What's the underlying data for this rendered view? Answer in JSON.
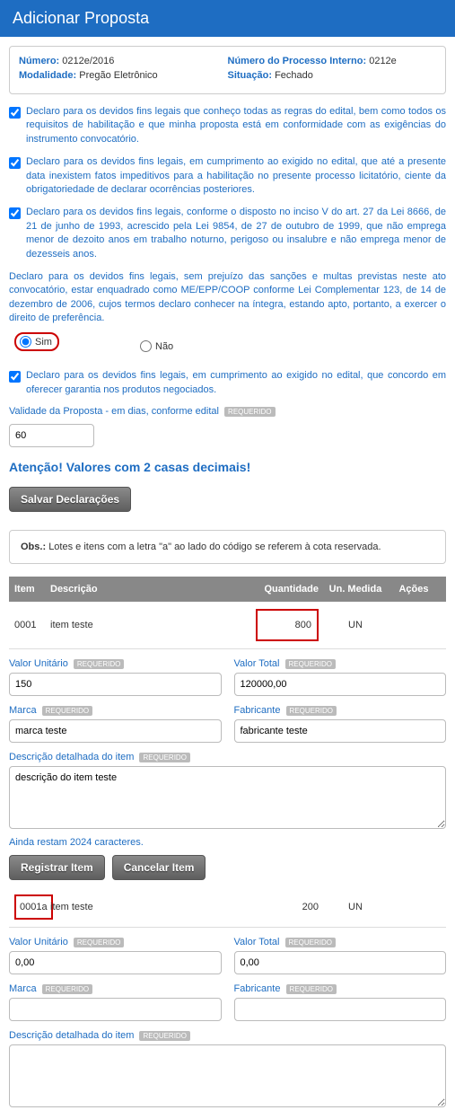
{
  "header": {
    "title": "Adicionar Proposta"
  },
  "info": {
    "numero_label": "Número:",
    "numero": "0212e/2016",
    "modalidade_label": "Modalidade:",
    "modalidade": "Pregão Eletrônico",
    "proc_interno_label": "Número do Processo Interno:",
    "proc_interno": "0212e",
    "situacao_label": "Situação:",
    "situacao": "Fechado"
  },
  "decl": {
    "d1": "Declaro para os devidos fins legais que conheço todas as regras do edital, bem como todos os requisitos de habilitação e que minha proposta está em conformidade com as exigências do instrumento convocatório.",
    "d2": "Declaro para os devidos fins legais, em cumprimento ao exigido no edital, que até a presente data inexistem fatos impeditivos para a habilitação no presente processo licitatório, ciente da obrigatoriedade de declarar ocorrências posteriores.",
    "d3": "Declaro para os devidos fins legais, conforme o disposto no inciso V do art. 27 da Lei 8666, de 21 de junho de 1993, acrescido pela Lei 9854, de 27 de outubro de 1999, que não emprega menor de dezoito anos em trabalho noturno, perigoso ou insalubre e não emprega menor de dezesseis anos.",
    "d4": "Declaro para os devidos fins legais, sem prejuízo das sanções e multas previstas neste ato convocatório, estar enquadrado como ME/EPP/COOP conforme Lei Complementar 123, de 14 de dezembro de 2006, cujos termos declaro conhecer na íntegra, estando apto, portanto, a exercer o direito de preferência.",
    "sim": "Sim",
    "nao": "Não",
    "d5": "Declaro para os devidos fins legais, em cumprimento ao exigido no edital, que concordo em oferecer garantia nos produtos negociados."
  },
  "validade": {
    "label": "Validade da Proposta - em dias, conforme edital",
    "value": "60",
    "required": "REQUERIDO"
  },
  "warning": "Atenção! Valores com 2 casas decimais!",
  "buttons": {
    "salvar": "Salvar Declarações",
    "registrar": "Registrar Item",
    "cancelar": "Cancelar Item"
  },
  "obs": {
    "label": "Obs.:",
    "text": "Lotes e itens com a letra \"a\" ao lado do código se referem à cota reservada."
  },
  "table": {
    "h_item": "Item",
    "h_desc": "Descrição",
    "h_qty": "Quantidade",
    "h_um": "Un. Medida",
    "h_act": "Ações"
  },
  "items": [
    {
      "code": "0001",
      "desc": "item teste",
      "qty": "800",
      "um": "UN"
    },
    {
      "code": "0001a",
      "desc": "item teste",
      "qty": "200",
      "um": "UN"
    }
  ],
  "form": {
    "valor_unit_label": "Valor Unitário",
    "valor_total_label": "Valor Total",
    "marca_label": "Marca",
    "fabricante_label": "Fabricante",
    "desc_label": "Descrição detalhada do item",
    "required": "REQUERIDO",
    "i1": {
      "valor_unit": "150",
      "valor_total": "120000,00",
      "marca": "marca teste",
      "fabricante": "fabricante teste",
      "desc": "descrição do item teste",
      "remain": "Ainda restam 2024 caracteres."
    },
    "i2": {
      "valor_unit": "0,00",
      "valor_total": "0,00",
      "marca": "",
      "fabricante": "",
      "desc": ""
    }
  }
}
